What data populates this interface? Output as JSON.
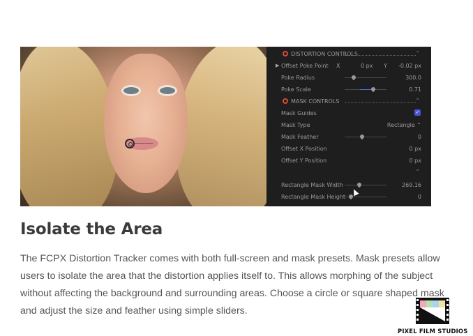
{
  "panel": {
    "distortion_header": "DISTORTION CONTROLS",
    "offset_poke_point": {
      "label": "Offset Poke Point",
      "x_label": "X",
      "x_value": "0 px",
      "y_label": "Y",
      "y_value": "-0.02 px"
    },
    "poke_radius": {
      "label": "Poke Radius",
      "value": "300.0"
    },
    "poke_scale": {
      "label": "Poke Scale",
      "value": "0.71"
    },
    "mask_header": "MASK CONTROLS",
    "mask_guides": {
      "label": "Mask Guides",
      "checked": true
    },
    "mask_type": {
      "label": "Mask Type",
      "value": "Rectangle ⌃"
    },
    "mask_feather": {
      "label": "Mask Feather",
      "value": "0"
    },
    "offset_x": {
      "label": "Offset X Position",
      "value": "0 px"
    },
    "offset_y": {
      "label": "Offset Y Position",
      "value": "0 px"
    },
    "rect_width": {
      "label": "Rectangle Mask Width",
      "value": "269.16"
    },
    "rect_height": {
      "label": "Rectangle Mask Height",
      "value": "0"
    }
  },
  "article": {
    "heading": "Isolate the Area",
    "body": "The FCPX Distortion Tracker comes with both full-screen and mask presets. Mask presets allow users to isolate the area that the distortion applies itself to. This allows morphing of the subject without affecting the background and surrounding areas. Choose a circle or square shaped mask and adjust the size and feather using simple sliders."
  },
  "logo": {
    "name": "PIXEL FILM STUDIOS"
  },
  "colors": {
    "accent_ring": "#d64a3a",
    "checkbox": "#4a56d8",
    "panel_bg": "#1e1e1e"
  }
}
